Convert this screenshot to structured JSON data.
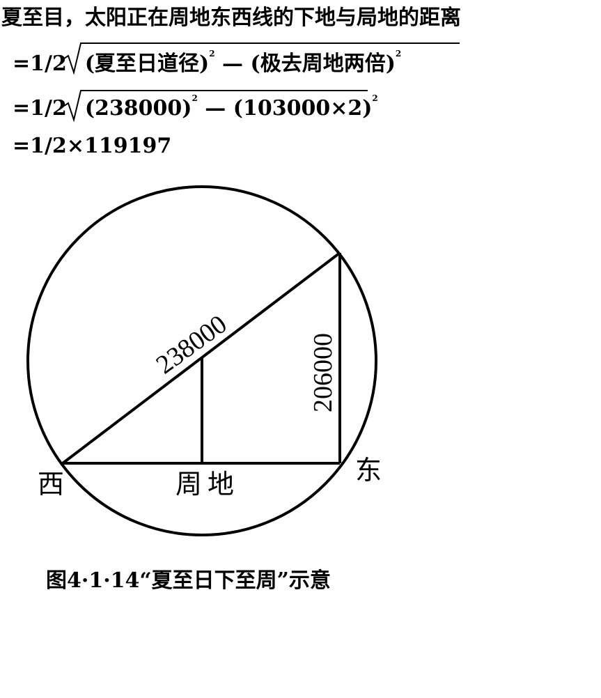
{
  "heading": "夏至目，太阳正在周地东西线的下地与局地的距离",
  "equations": {
    "line1_prefix": "=1/2",
    "line1_radicand_a": "(夏至日道径)",
    "line1_sup_a": "2",
    "line1_minus": "—",
    "line1_radicand_b": "(极去周地两倍)",
    "line1_sup_b": "2",
    "line2_prefix": "=1/2",
    "line2_radicand_a": "(238000)",
    "line2_sup_a": "2",
    "line2_minus": "—",
    "line2_radicand_b": "(103000×2)",
    "line2_sup_b": "2",
    "line3": "=1/2×119197"
  },
  "diagram": {
    "hypotenuse_label": "238000",
    "vertical_label": "206000",
    "west_label": "西",
    "center_label": "周地",
    "east_label": "东",
    "stroke_color": "#000000"
  },
  "caption": "图4·1·14“夏至日下至周”示意"
}
